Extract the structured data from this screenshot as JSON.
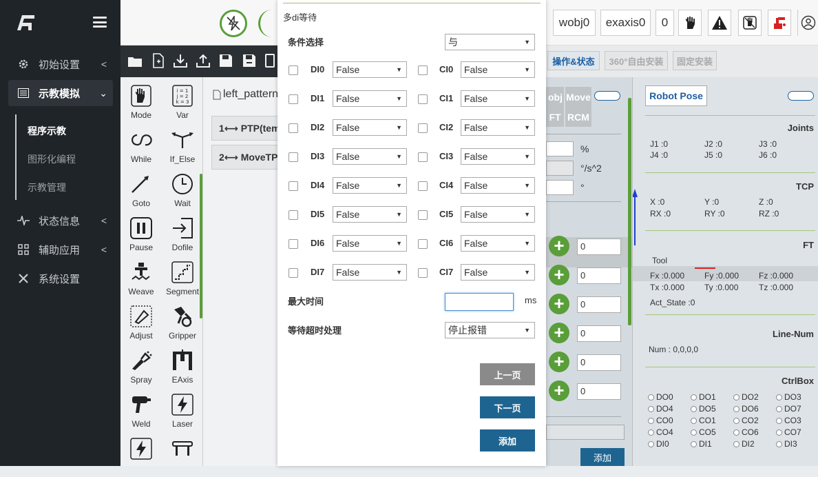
{
  "sidebar": {
    "nav": [
      {
        "label": "初始设置",
        "icon": "gear-icon"
      },
      {
        "label": "示教模拟",
        "icon": "list-icon"
      },
      {
        "label": "状态信息",
        "icon": "pulse-icon"
      },
      {
        "label": "辅助应用",
        "icon": "grid-icon"
      },
      {
        "label": "系统设置",
        "icon": "tools-icon"
      }
    ],
    "sub": [
      "程序示教",
      "图形化编程",
      "示教管理"
    ]
  },
  "topbar": {
    "wobj": "wobj0",
    "exaxis": "exaxis0",
    "num": "0"
  },
  "palette": [
    {
      "label": "Mode",
      "icon": "hand-icon"
    },
    {
      "label": "Var",
      "icon": "variables-icon"
    },
    {
      "label": "While",
      "icon": "loop-icon"
    },
    {
      "label": "If_Else",
      "icon": "branch-icon"
    },
    {
      "label": "Goto",
      "icon": "goto-icon"
    },
    {
      "label": "Wait",
      "icon": "clock-icon"
    },
    {
      "label": "Pause",
      "icon": "pause-icon"
    },
    {
      "label": "Dofile",
      "icon": "login-icon"
    },
    {
      "label": "Weave",
      "icon": "weave-icon"
    },
    {
      "label": "Segment",
      "icon": "segment-icon"
    },
    {
      "label": "Adjust",
      "icon": "adjust-icon"
    },
    {
      "label": "Gripper",
      "icon": "gripper-icon"
    },
    {
      "label": "Spray",
      "icon": "spray-icon"
    },
    {
      "label": "EAxis",
      "icon": "eaxis-icon"
    },
    {
      "label": "Weld",
      "icon": "weld-icon"
    },
    {
      "label": "Laser",
      "icon": "laser-icon"
    }
  ],
  "program": {
    "file": "left_pattern",
    "lines": [
      "1⟷ PTP(tem",
      "2⟷ MoveTPD"
    ]
  },
  "modal": {
    "title": "多di等待",
    "cond_label": "条件选择",
    "cond_value": "与",
    "di_labels": [
      "DI0",
      "DI1",
      "DI2",
      "DI3",
      "DI4",
      "DI5",
      "DI6",
      "DI7"
    ],
    "ci_labels": [
      "CI0",
      "CI1",
      "CI2",
      "CI3",
      "CI4",
      "CI5",
      "CI6",
      "CI7"
    ],
    "false_value": "False",
    "max_time_label": "最大时间",
    "max_time_unit": "ms",
    "max_time_value": "",
    "timeout_label": "等待超时处理",
    "timeout_value": "停止报错",
    "btn_prev": "上一页",
    "btn_next": "下一页",
    "btn_add": "添加"
  },
  "tabs": [
    "操作&状态",
    "360°自由安装",
    "固定安装"
  ],
  "mid": {
    "obj": "obj",
    "move": "Move",
    "ft": "FT",
    "rcm": "RCM",
    "units": [
      "%",
      "°/s^2",
      "°"
    ],
    "values": [
      "0",
      "0",
      "0",
      "0",
      "0",
      "0"
    ],
    "add": "添加"
  },
  "robot": {
    "title": "Robot Pose",
    "joints_t": "Joints",
    "joints": [
      "J1 :0",
      "J2 :0",
      "J3 :0",
      "J4 :0",
      "J5 :0",
      "J6 :0"
    ],
    "tcp_t": "TCP",
    "tcp": [
      "X :0",
      "Y :0",
      "Z :0",
      "RX :0",
      "RY :0",
      "RZ :0"
    ],
    "ft_t": "FT",
    "tool": "Tool",
    "ft": [
      "Fx :0.000",
      "Fy :0.000",
      "Fz :0.000",
      "Tx :0.000",
      "Ty :0.000",
      "Tz :0.000"
    ],
    "act_state": "Act_State :0",
    "line_t": "Line-Num",
    "line": "Num  : 0,0,0,0",
    "ctrl_t": "CtrlBox",
    "ctrl": [
      "DO0",
      "DO1",
      "DO2",
      "DO3",
      "DO4",
      "DO5",
      "DO6",
      "DO7",
      "CO0",
      "CO1",
      "CO2",
      "CO3",
      "CO4",
      "CO5",
      "CO6",
      "CO7",
      "DI0",
      "DI1",
      "DI2",
      "DI3"
    ]
  },
  "colors": {
    "sidebar": "#1f2428",
    "btn_gray": "#8a8a8a",
    "btn_blue": "#1e6491",
    "accent_blue": "#1d5fa3",
    "green": "#5a9e3a"
  }
}
